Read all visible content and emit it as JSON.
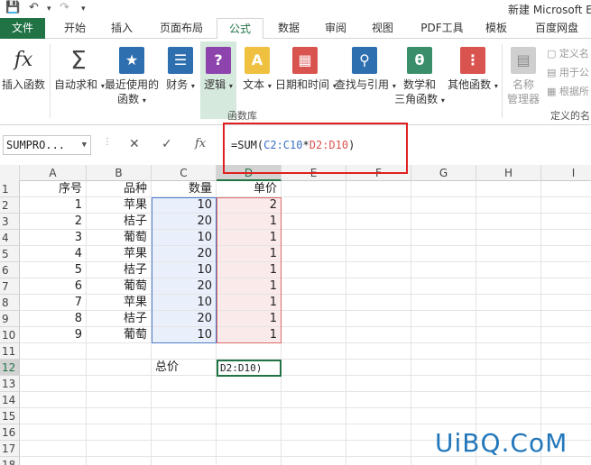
{
  "title": "新建 Microsoft E",
  "tabs": [
    "文件",
    "开始",
    "插入",
    "页面布局",
    "公式",
    "数据",
    "审阅",
    "视图",
    "PDF工具",
    "模板",
    "百度网盘"
  ],
  "active_tab": "公式",
  "ribbon": {
    "insert_function": "插入函数",
    "autosum": "自动求和",
    "recent_line1": "最近使用的",
    "recent_line2": "函数",
    "financial": "财务",
    "logical": "逻辑",
    "text": "文本",
    "datetime": "日期和时间",
    "lookup": "查找与引用",
    "math_line1": "数学和",
    "math_line2": "三角函数",
    "more": "其他函数",
    "name_mgr_line1": "名称",
    "name_mgr_line2": "管理器",
    "define_name": "定义名",
    "use_in_formula": "用于公",
    "create_from_sel": "根据所",
    "group_label": "函数库",
    "group_label2": "定义的名"
  },
  "formula_bar": {
    "name_box": "SUMPRO...",
    "cancel_icon": "✕",
    "enter_icon": "✓",
    "fx": "fx",
    "formula_prefix": "=SUM(",
    "formula_ref1": "C2:C10",
    "formula_op": "*",
    "formula_ref2": "D2:D10",
    "formula_suffix": ")"
  },
  "columns": [
    "A",
    "B",
    "C",
    "D",
    "E",
    "F",
    "G",
    "H",
    "I"
  ],
  "rows": [
    "1",
    "2",
    "3",
    "4",
    "5",
    "6",
    "7",
    "8",
    "9",
    "10",
    "11",
    "12",
    "13",
    "14",
    "15",
    "16",
    "17",
    "18"
  ],
  "header_row": [
    "序号",
    "品种",
    "数量",
    "单价"
  ],
  "data_rows": [
    [
      "1",
      "苹果",
      "10",
      "2"
    ],
    [
      "2",
      "桔子",
      "20",
      "1"
    ],
    [
      "3",
      "葡萄",
      "10",
      "1"
    ],
    [
      "4",
      "苹果",
      "20",
      "1"
    ],
    [
      "5",
      "桔子",
      "10",
      "1"
    ],
    [
      "6",
      "葡萄",
      "20",
      "1"
    ],
    [
      "7",
      "苹果",
      "10",
      "1"
    ],
    [
      "8",
      "桔子",
      "20",
      "1"
    ],
    [
      "9",
      "葡萄",
      "10",
      "1"
    ]
  ],
  "total_label": "总价",
  "active_cell_text": "D2:D10)",
  "watermark": "UiBQ.CoM",
  "colors": {
    "accent": "#217346",
    "ref_blue": "#3a6fc6",
    "ref_red": "#d9534f",
    "highlight": "#e02020"
  }
}
